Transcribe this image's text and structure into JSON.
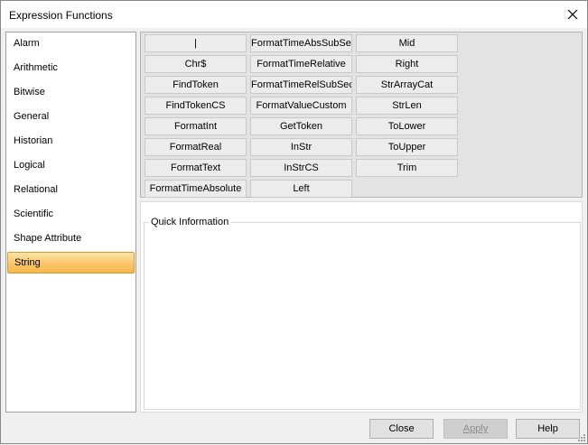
{
  "window": {
    "title": "Expression Functions"
  },
  "sidebar": {
    "items": [
      {
        "label": "Alarm"
      },
      {
        "label": "Arithmetic"
      },
      {
        "label": "Bitwise"
      },
      {
        "label": "General"
      },
      {
        "label": "Historian"
      },
      {
        "label": "Logical"
      },
      {
        "label": "Relational"
      },
      {
        "label": "Scientific"
      },
      {
        "label": "Shape Attribute"
      },
      {
        "label": "String"
      }
    ],
    "selected": "String"
  },
  "functions": {
    "columns": [
      [
        "|",
        "Chr$",
        "FindToken",
        "FindTokenCS",
        "FormatInt",
        "FormatReal",
        "FormatText",
        "FormatTimeAbsolute"
      ],
      [
        "FormatTimeAbsSubSec",
        "FormatTimeRelative",
        "FormatTimeRelSubSec",
        "FormatValueCustom",
        "GetToken",
        "InStr",
        "InStrCS",
        "Left"
      ],
      [
        "Mid",
        "Right",
        "StrArrayCat",
        "StrLen",
        "ToLower",
        "ToUpper",
        "Trim"
      ]
    ]
  },
  "quick_info": {
    "label": "Quick Information",
    "content": ""
  },
  "buttons": {
    "close": "Close",
    "apply": "Apply",
    "help": "Help"
  },
  "colors": {
    "selected_gradient_top": "#fde4a9",
    "selected_gradient_bottom": "#f7b94a",
    "selected_border": "#d99a2b"
  }
}
